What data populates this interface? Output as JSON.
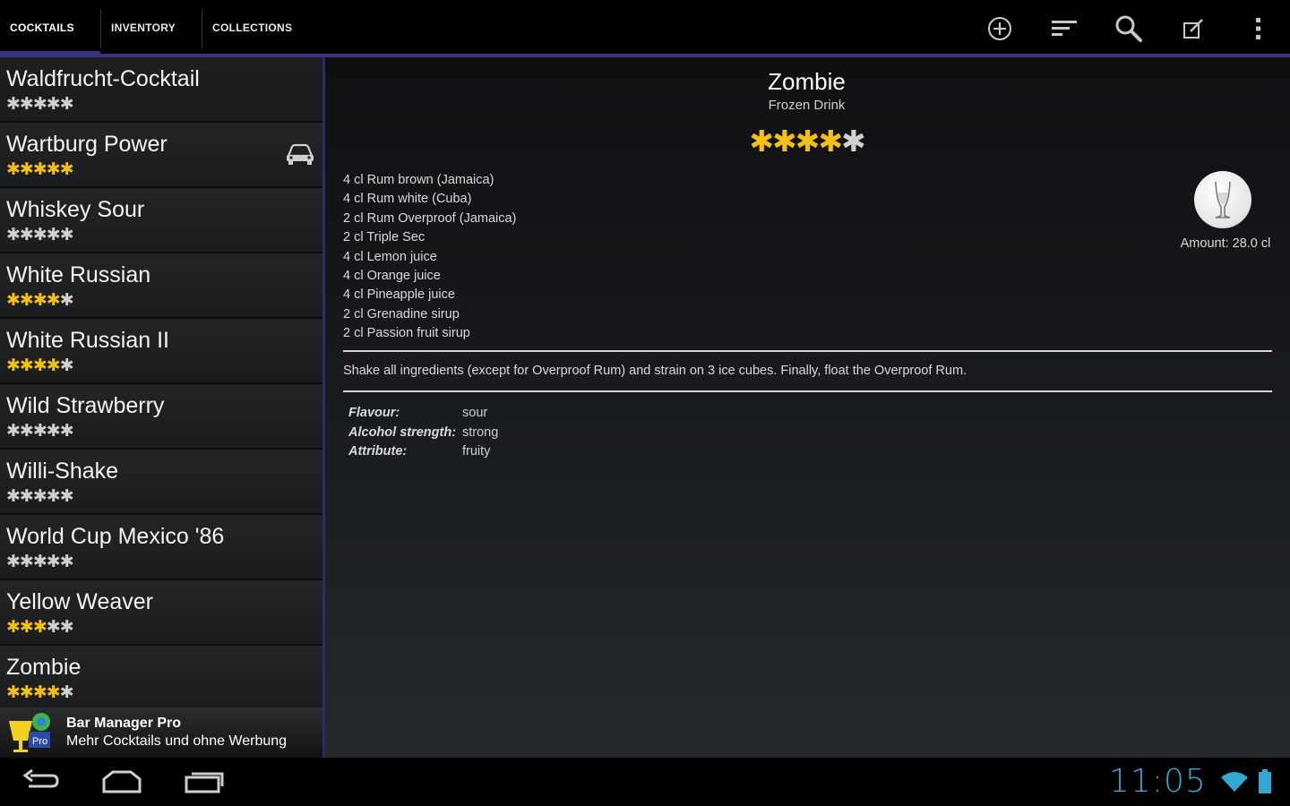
{
  "tabs": [
    {
      "label": "COCKTAILS",
      "selected": true
    },
    {
      "label": "INVENTORY",
      "selected": false
    },
    {
      "label": "COLLECTIONS",
      "selected": false
    }
  ],
  "actions": [
    "add-icon",
    "sort-icon",
    "search-icon",
    "edit-icon",
    "overflow-menu-icon"
  ],
  "list": [
    {
      "name": "Waldfrucht-Cocktail",
      "rating": 0
    },
    {
      "name": "Wartburg Power",
      "rating": 5,
      "car": true
    },
    {
      "name": "Whiskey Sour",
      "rating": 0
    },
    {
      "name": "White Russian",
      "rating": 4
    },
    {
      "name": "White Russian II",
      "rating": 4
    },
    {
      "name": "Wild Strawberry",
      "rating": 0
    },
    {
      "name": "Willi-Shake",
      "rating": 0
    },
    {
      "name": "World Cup Mexico '86",
      "rating": 0
    },
    {
      "name": "Yellow Weaver",
      "rating": 3
    },
    {
      "name": "Zombie",
      "rating": 4
    }
  ],
  "promo": {
    "title": "Bar Manager Pro",
    "text": "Mehr Cocktails und ohne Werbung",
    "logo_label": "Pro"
  },
  "detail": {
    "title": "Zombie",
    "subtitle": "Frozen Drink",
    "rating": 4,
    "ingredients": [
      "4 cl Rum brown (Jamaica)",
      "4 cl Rum white (Cuba)",
      "2 cl Rum Overproof (Jamaica)",
      "2 cl Triple Sec",
      "4 cl Lemon juice",
      "4 cl Orange juice",
      "4 cl Pineapple juice",
      "2 cl Grenadine sirup",
      "2 cl Passion fruit sirup"
    ],
    "amount": "Amount: 28.0 cl",
    "instructions": "Shake all ingredients (except for Overproof Rum) and strain on 3 ice cubes. Finally, float the Overproof Rum.",
    "attributes": [
      {
        "key": "Flavour:",
        "value": "sour"
      },
      {
        "key": "Alcohol strength:",
        "value": "strong"
      },
      {
        "key": "Attribute:",
        "value": "fruity"
      }
    ]
  },
  "system": {
    "time": "11:05"
  },
  "colors": {
    "accent": "#3a3480",
    "star": "#f4c013",
    "clock": "#33a8d4"
  }
}
